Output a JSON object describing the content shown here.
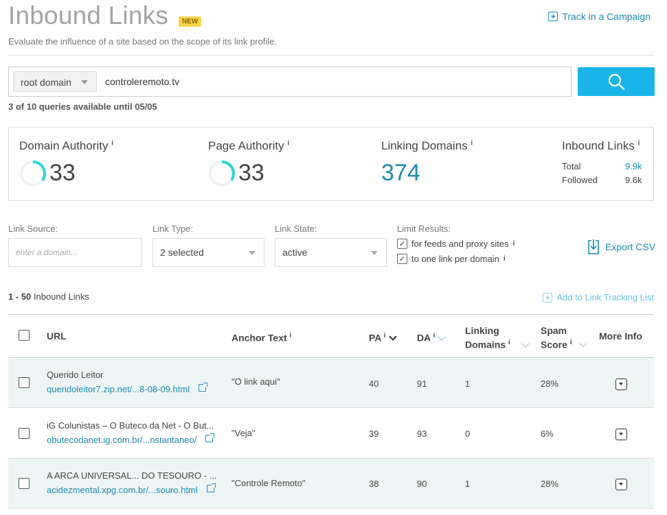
{
  "header": {
    "title": "Inbound Links",
    "badge": "NEW",
    "track_link": "Track in a Campaign",
    "subtitle": "Evaluate the influence of a site based on the scope of its link profile."
  },
  "search": {
    "scope": "root domain",
    "query": "controleremoto.tv",
    "quota": "3 of 10 queries available until 05/05"
  },
  "metrics": {
    "domain_authority": {
      "label": "Domain Authority",
      "value": "33"
    },
    "page_authority": {
      "label": "Page Authority",
      "value": "33"
    },
    "linking_domains": {
      "label": "Linking Domains",
      "value": "374"
    },
    "inbound_links": {
      "label": "Inbound Links",
      "total_label": "Total",
      "total_value": "9.9k",
      "followed_label": "Followed",
      "followed_value": "9.6k"
    },
    "info_marker": "i"
  },
  "filters": {
    "link_source": {
      "label": "Link Source:",
      "placeholder": "enter a domain..."
    },
    "link_type": {
      "label": "Link Type:",
      "value": "2 selected"
    },
    "link_state": {
      "label": "Link State:",
      "value": "active"
    },
    "limit": {
      "label": "Limit Results:",
      "opt1": "for feeds and proxy sites",
      "opt2": "to one link per domain",
      "check": "✓"
    },
    "export": "Export CSV"
  },
  "results": {
    "range": "1 - 50",
    "range_label": "Inbound Links",
    "add_tracking": "Add to Link Tracking List"
  },
  "table": {
    "columns": {
      "url": "URL",
      "anchor": "Anchor Text",
      "pa": "PA",
      "da": "DA",
      "linking_domains_1": "Linking",
      "linking_domains_2": "Domains",
      "spam_1": "Spam",
      "spam_2": "Score",
      "more": "More Info"
    },
    "rows": [
      {
        "title": "Querido Leitor",
        "url": "queridoleitor7.zip.net/...8-08-09.html",
        "anchor": "\"O link aqui\"",
        "pa": "40",
        "da": "91",
        "ld": "1",
        "spam": "28%"
      },
      {
        "title": "iG Colunistas – O Buteco da Net - O But...",
        "url": "obutecodanet.ig.com.br/...nstantaneo/",
        "anchor": "\"Veja\"",
        "pa": "39",
        "da": "93",
        "ld": "0",
        "spam": "6%"
      },
      {
        "title": "A ARCA UNIVERSAL... DO TESOURO - ...",
        "url": "acidezmental.xpg.com.br/...souro.html",
        "anchor": "\"Controle Remoto\"",
        "pa": "38",
        "da": "90",
        "ld": "1",
        "spam": "28%"
      }
    ]
  },
  "colors": {
    "accent": "#1d8ab1",
    "search_button": "#19b5e8",
    "ring": "#2ed4d8",
    "badge": "#fcd24a",
    "row_alt": "#eef6f5"
  }
}
